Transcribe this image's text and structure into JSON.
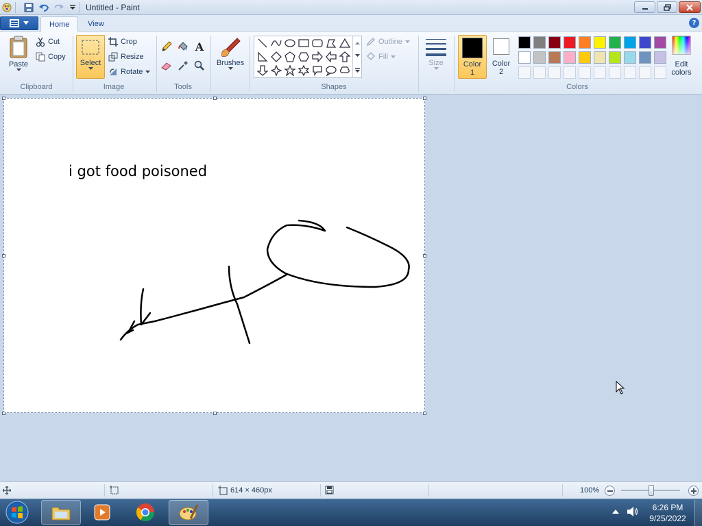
{
  "window": {
    "title": "Untitled - Paint"
  },
  "tabs": [
    {
      "label": "Home"
    },
    {
      "label": "View"
    }
  ],
  "ribbon": {
    "clipboard": {
      "group": "Clipboard",
      "paste": "Paste",
      "cut": "Cut",
      "copy": "Copy"
    },
    "image": {
      "group": "Image",
      "select": "Select",
      "crop": "Crop",
      "resize": "Resize",
      "rotate": "Rotate"
    },
    "tools": {
      "group": "Tools"
    },
    "brushes": {
      "label": "Brushes"
    },
    "shapes": {
      "group": "Shapes",
      "outline": "Outline",
      "fill": "Fill"
    },
    "size": {
      "label": "Size"
    },
    "colors": {
      "group": "Colors",
      "color1_line1": "Color",
      "color1_line2": "1",
      "color2_line1": "Color",
      "color2_line2": "2",
      "edit_line1": "Edit",
      "edit_line2": "colors",
      "color1_value": "#000000",
      "color2_value": "#ffffff",
      "palette_row1": [
        "#000000",
        "#7f7f7f",
        "#880015",
        "#ed1c24",
        "#ff7f27",
        "#fff200",
        "#22b14c",
        "#00a2e8",
        "#3f48cc",
        "#a349a4"
      ],
      "palette_row2": [
        "#ffffff",
        "#c3c3c3",
        "#b97a57",
        "#ffaec9",
        "#ffc90e",
        "#efe4b0",
        "#b5e61d",
        "#99d9ea",
        "#7092be",
        "#c8bfe7"
      ]
    }
  },
  "canvas": {
    "text": "i got food poisoned"
  },
  "status": {
    "dimensions": "614 × 460px",
    "zoom": "100%"
  },
  "taskbar": {
    "time": "6:26 PM",
    "date": "9/25/2022"
  }
}
